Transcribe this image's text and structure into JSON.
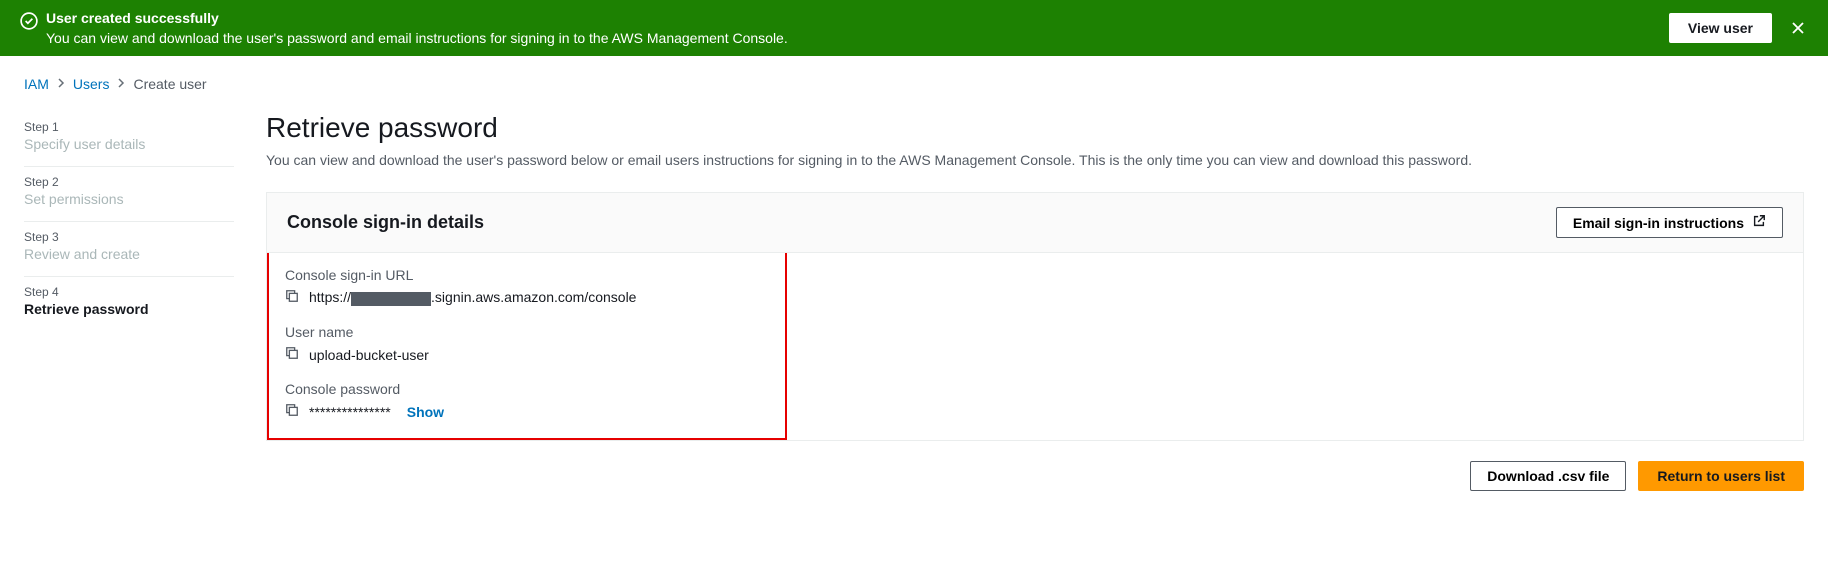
{
  "banner": {
    "title": "User created successfully",
    "description": "You can view and download the user's password and email instructions for signing in to the AWS Management Console.",
    "view_button": "View user"
  },
  "breadcrumb": {
    "iam": "IAM",
    "users": "Users",
    "current": "Create user"
  },
  "steps": [
    {
      "num": "Step 1",
      "label": "Specify user details"
    },
    {
      "num": "Step 2",
      "label": "Set permissions"
    },
    {
      "num": "Step 3",
      "label": "Review and create"
    },
    {
      "num": "Step 4",
      "label": "Retrieve password"
    }
  ],
  "page": {
    "title": "Retrieve password",
    "description": "You can view and download the user's password below or email users instructions for signing in to the AWS Management Console. This is the only time you can view and download this password."
  },
  "panel": {
    "title": "Console sign-in details",
    "email_button": "Email sign-in instructions"
  },
  "details": {
    "signin_url_label": "Console sign-in URL",
    "signin_url_prefix": "https://",
    "signin_url_suffix": ".signin.aws.amazon.com/console",
    "username_label": "User name",
    "username_value": "upload-bucket-user",
    "password_label": "Console password",
    "password_value": "***************",
    "show_label": "Show"
  },
  "footer": {
    "download": "Download .csv file",
    "return": "Return to users list"
  }
}
